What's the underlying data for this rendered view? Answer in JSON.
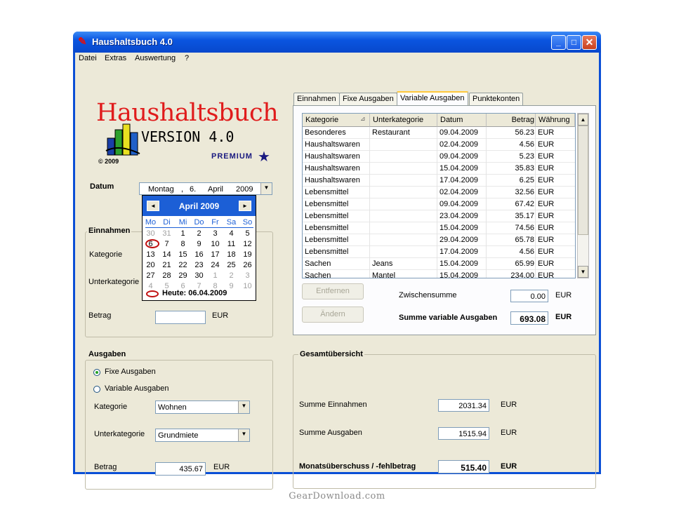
{
  "window": {
    "title": "Haushaltsbuch 4.0"
  },
  "menu": [
    "Datei",
    "Extras",
    "Auswertung",
    "?"
  ],
  "logo": {
    "title": "Haushaltsbuch",
    "version": "VERSION 4.0",
    "edition": "PREMIUM",
    "copyright": "© 2009"
  },
  "datum": {
    "label": "Datum",
    "weekday": "Montag",
    "sep": ",",
    "day": "6.",
    "month": "April",
    "year": "2009"
  },
  "calendar": {
    "month_label": "April 2009",
    "prev": "◄",
    "next": "►",
    "dow": [
      "Mo",
      "Di",
      "Mi",
      "Do",
      "Fr",
      "Sa",
      "So"
    ],
    "weeks": [
      [
        "30",
        "31",
        "1",
        "2",
        "3",
        "4",
        "5"
      ],
      [
        "6",
        "7",
        "8",
        "9",
        "10",
        "11",
        "12"
      ],
      [
        "13",
        "14",
        "15",
        "16",
        "17",
        "18",
        "19"
      ],
      [
        "20",
        "21",
        "22",
        "23",
        "24",
        "25",
        "26"
      ],
      [
        "27",
        "28",
        "29",
        "30",
        "1",
        "2",
        "3"
      ],
      [
        "4",
        "5",
        "6",
        "7",
        "8",
        "9",
        "10"
      ]
    ],
    "today_label": "Heute: 06.04.2009"
  },
  "einnahmen": {
    "title": "Einnahmen",
    "kategorie": "Kategorie",
    "unterkategorie": "Unterkategorie",
    "betrag": "Betrag",
    "currency": "EUR",
    "betrag_value": ""
  },
  "ausgaben": {
    "title": "Ausgaben",
    "radio_fixe": "Fixe Ausgaben",
    "radio_variable": "Variable Ausgaben",
    "kategorie_label": "Kategorie",
    "kategorie_value": "Wohnen",
    "unterkategorie_label": "Unterkategorie",
    "unterkategorie_value": "Grundmiete",
    "betrag_label": "Betrag",
    "betrag_value": "435.67",
    "currency": "EUR"
  },
  "tabs": [
    "Einnahmen",
    "Fixe Ausgaben",
    "Variable Ausgaben",
    "Punktekonten"
  ],
  "list": {
    "headers": [
      "Kategorie",
      "Unterkategorie",
      "Datum",
      "Betrag",
      "Währung"
    ],
    "sort_icon": "⊿",
    "rows": [
      [
        "Besonderes",
        "Restaurant",
        "09.04.2009",
        "56.23",
        "EUR"
      ],
      [
        "Haushaltswaren",
        "",
        "02.04.2009",
        "4.56",
        "EUR"
      ],
      [
        "Haushaltswaren",
        "",
        "09.04.2009",
        "5.23",
        "EUR"
      ],
      [
        "Haushaltswaren",
        "",
        "15.04.2009",
        "35.83",
        "EUR"
      ],
      [
        "Haushaltswaren",
        "",
        "17.04.2009",
        "6.25",
        "EUR"
      ],
      [
        "Lebensmittel",
        "",
        "02.04.2009",
        "32.56",
        "EUR"
      ],
      [
        "Lebensmittel",
        "",
        "09.04.2009",
        "67.42",
        "EUR"
      ],
      [
        "Lebensmittel",
        "",
        "23.04.2009",
        "35.17",
        "EUR"
      ],
      [
        "Lebensmittel",
        "",
        "15.04.2009",
        "74.56",
        "EUR"
      ],
      [
        "Lebensmittel",
        "",
        "29.04.2009",
        "65.78",
        "EUR"
      ],
      [
        "Lebensmittel",
        "",
        "17.04.2009",
        "4.56",
        "EUR"
      ],
      [
        "Sachen",
        "Jeans",
        "15.04.2009",
        "65.99",
        "EUR"
      ],
      [
        "Sachen",
        "Mantel",
        "15.04.2009",
        "234.00",
        "EUR"
      ]
    ]
  },
  "buttons": {
    "entfernen": "Entfernen",
    "aendern": "Ändern"
  },
  "zwischensumme": {
    "label": "Zwischensumme",
    "value": "0.00",
    "currency": "EUR"
  },
  "summe_variable": {
    "label": "Summe variable Ausgaben",
    "value": "693.08",
    "currency": "EUR"
  },
  "gesamt": {
    "title": "Gesamtübersicht",
    "einnahmen_label": "Summe Einnahmen",
    "einnahmen_value": "2031.34",
    "ausgaben_label": "Summe Ausgaben",
    "ausgaben_value": "1515.94",
    "ueberschuss_label": "Monatsüberschuss / -fehlbetrag",
    "ueberschuss_value": "515.40",
    "currency": "EUR"
  },
  "footer": {
    "watermark": "GearDownload.com"
  }
}
